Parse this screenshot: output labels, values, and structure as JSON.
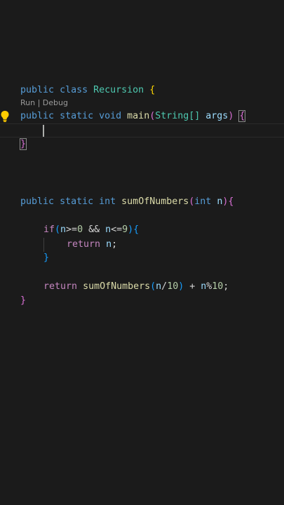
{
  "editor": {
    "class_decl": {
      "kw1": "public",
      "kw2": "class",
      "name": "Recursion",
      "brace": "{"
    },
    "codelens": {
      "run": "Run",
      "sep": " | ",
      "debug": "Debug"
    },
    "main_decl": {
      "kw1": "public",
      "kw2": "static",
      "kw3": "void",
      "name": "main",
      "paren_open": "(",
      "param_type": "String[]",
      "param_name": "args",
      "paren_close": ")",
      "brace": "{"
    },
    "main_close": "}",
    "sum_decl": {
      "kw1": "public",
      "kw2": "static",
      "kw3": "int",
      "name": "sumOfNumbers",
      "paren_open": "(",
      "param_type": "int",
      "param_name": "n",
      "paren_close": ")",
      "brace": "{"
    },
    "if_line": {
      "kw": "if",
      "paren_open": "(",
      "v1": "n",
      "op1": ">=",
      "n1": "0",
      "op2": " && ",
      "v2": "n",
      "op3": "<=",
      "n2": "9",
      "paren_close": ")",
      "brace": "{"
    },
    "return_n": {
      "kw": "return",
      "v": "n",
      "semi": ";"
    },
    "if_close": "}",
    "return_rec": {
      "kw": "return",
      "fn": "sumOfNumbers",
      "paren_open": "(",
      "v": "n",
      "op1": "/",
      "n1": "10",
      "paren_close": ")",
      "op2": " + ",
      "v2": "n",
      "op3": "%",
      "n2": "10",
      "semi": ";"
    },
    "sum_close": "}"
  },
  "colors": {
    "background": "#1b1b1b",
    "keyword": "#569cd6",
    "control": "#c586c0",
    "type": "#4ec9b0",
    "function": "#dcdcaa",
    "variable": "#9cdcfe",
    "number": "#b5cea8"
  },
  "icons": {
    "lightbulb": "lightbulb-icon"
  }
}
